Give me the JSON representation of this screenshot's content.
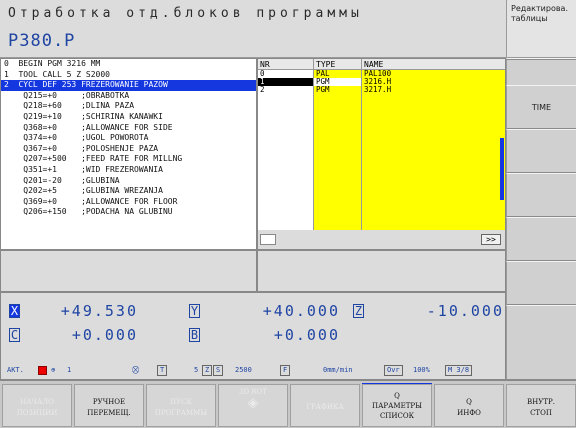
{
  "header": {
    "mode_title": "Отработка отд.блоков программы",
    "program_name": "P380.P",
    "edit_mode": [
      "Редактирова.",
      "таблицы"
    ]
  },
  "program": {
    "lines": [
      "0  BEGIN PGM 3216 MM",
      "1  TOOL CALL 5 Z S2000",
      "2  CYCL DEF 253 FREZEROWANIE PAZOW",
      "    Q215=+0     ;OBRABOTKA",
      "    Q218=+60    ;DLINA PAZA",
      "    Q219=+10    ;SCHIRINA KANAWKI",
      "    Q368=+0     ;ALLOWANCE FOR SIDE",
      "    Q374=+0     ;UGOL POWOROTA",
      "    Q367=+0     ;POLOSHENJE PAZA",
      "    Q207=+500   ;FEED RATE FOR MILLNG",
      "    Q351=+1     ;WID FREZEROWANIA",
      "    Q201=-20    ;GLUBINA",
      "    Q202=+5     ;GLUBINA WREZANJA",
      "    Q369=+0     ;ALLOWANCE FOR FLOOR",
      "    Q206=+150   ;PODACHA NA GLUBINU"
    ]
  },
  "pallet_table": {
    "headers": [
      "NR",
      "TYPE",
      "NAME"
    ],
    "rows": [
      {
        "nr": "0",
        "type": "PAL",
        "name": "PAL100"
      },
      {
        "nr": "1",
        "type": "PGM",
        "name": "3216.H"
      },
      {
        "nr": "2",
        "type": "PGM",
        "name": "3217.H"
      }
    ],
    "scroll_button": ">>"
  },
  "positions": {
    "axes": [
      {
        "letter": "X",
        "value": "+49.530"
      },
      {
        "letter": "Y",
        "value": "+40.000"
      },
      {
        "letter": "Z",
        "value": "-10.000"
      },
      {
        "letter": "C",
        "value": "+0.000"
      },
      {
        "letter": "B",
        "value": "+0.000"
      }
    ]
  },
  "status": {
    "akt_label": "АКТ.",
    "tool_nr": "1",
    "t_label": "T",
    "t_value": "5",
    "z_label": "Z",
    "s_label": "S",
    "s_value": "2500",
    "f_label": "F",
    "f_value": "0mm/min",
    "ovr_label": "Ovr",
    "ovr_value": "100%",
    "m_value": "M 3/8"
  },
  "softkeys_right": [
    "",
    "",
    "TIME",
    "",
    "",
    "",
    ""
  ],
  "softkeys_bottom": [
    {
      "label": [
        "НАЧАЛО",
        "ПОЗИЦИИ"
      ],
      "enabled": false
    },
    {
      "label": [
        "РУЧНОЕ",
        "ПЕРЕМЕЩ."
      ],
      "enabled": true
    },
    {
      "label": [
        "ПУСК",
        "ПРОГРАММЫ"
      ],
      "enabled": false
    },
    {
      "label": [
        "3D ROT"
      ],
      "enabled": false
    },
    {
      "label": [
        "ГРАФИКА"
      ],
      "enabled": false
    },
    {
      "label": [
        "Q",
        "ПАРАМЕТРЫ",
        "СПИСОК"
      ],
      "enabled": true
    },
    {
      "label": [
        "Q",
        "ИНФО"
      ],
      "enabled": true
    },
    {
      "label": [
        "ВНУТР.",
        "СТОП"
      ],
      "enabled": true
    }
  ]
}
